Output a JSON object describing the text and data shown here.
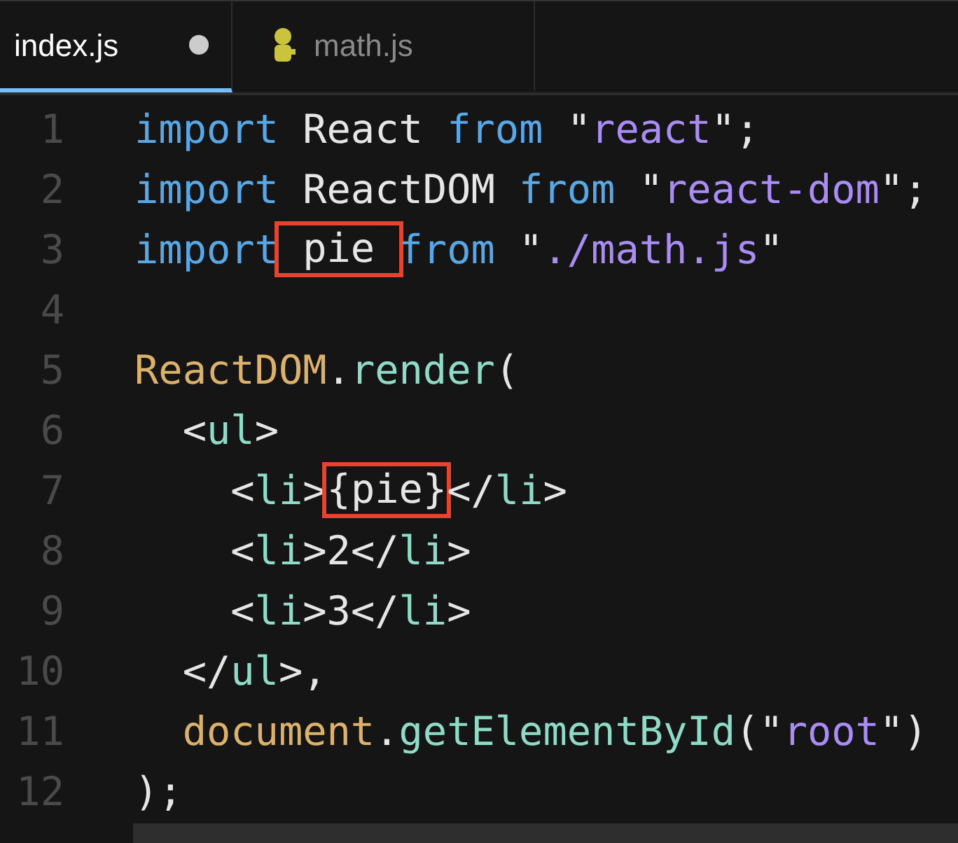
{
  "tabs": [
    {
      "label": "index.js",
      "selected": true,
      "modified": true,
      "icon": false
    },
    {
      "label": "math.js",
      "selected": false,
      "modified": false,
      "icon": true
    }
  ],
  "lines": [
    {
      "number": "1",
      "tokens": [
        {
          "text": "import",
          "kind": "keyword"
        },
        {
          "text": " React ",
          "kind": "plain"
        },
        {
          "text": "from",
          "kind": "keyword"
        },
        {
          "text": " \"",
          "kind": "plain"
        },
        {
          "text": "react",
          "kind": "string"
        },
        {
          "text": "\";",
          "kind": "plain"
        }
      ]
    },
    {
      "number": "2",
      "tokens": [
        {
          "text": "import",
          "kind": "keyword"
        },
        {
          "text": " ReactDOM ",
          "kind": "plain"
        },
        {
          "text": "from",
          "kind": "keyword"
        },
        {
          "text": " \"",
          "kind": "plain"
        },
        {
          "text": "react-dom",
          "kind": "string"
        },
        {
          "text": "\";",
          "kind": "plain"
        }
      ]
    },
    {
      "number": "3",
      "tokens": [
        {
          "text": "import",
          "kind": "keyword"
        },
        {
          "text": " pie ",
          "kind": "plain",
          "boxed": true
        },
        {
          "text": "from",
          "kind": "keyword"
        },
        {
          "text": " \"",
          "kind": "plain"
        },
        {
          "text": "./math.js",
          "kind": "string"
        },
        {
          "text": "\"",
          "kind": "plain"
        }
      ]
    },
    {
      "number": "4"
    },
    {
      "number": "5",
      "tokens": [
        {
          "text": "ReactDOM",
          "kind": "object"
        },
        {
          "text": ".",
          "kind": "plain"
        },
        {
          "text": "render",
          "kind": "method"
        },
        {
          "text": "(",
          "kind": "plain"
        }
      ]
    },
    {
      "number": "6",
      "tokens": [
        {
          "text": "  <",
          "kind": "plain"
        },
        {
          "text": "ul",
          "kind": "tag"
        },
        {
          "text": ">",
          "kind": "plain"
        }
      ]
    },
    {
      "number": "7",
      "tokens": [
        {
          "text": "    <",
          "kind": "plain"
        },
        {
          "text": "li",
          "kind": "tag"
        },
        {
          "text": ">",
          "kind": "plain"
        },
        {
          "text": "{pie}",
          "kind": "plain",
          "boxed": true
        },
        {
          "text": "</",
          "kind": "plain"
        },
        {
          "text": "li",
          "kind": "tag"
        },
        {
          "text": ">",
          "kind": "plain"
        }
      ]
    },
    {
      "number": "8",
      "tokens": [
        {
          "text": "    <",
          "kind": "plain"
        },
        {
          "text": "li",
          "kind": "tag"
        },
        {
          "text": ">2</",
          "kind": "plain"
        },
        {
          "text": "li",
          "kind": "tag"
        },
        {
          "text": ">",
          "kind": "plain"
        }
      ]
    },
    {
      "number": "9",
      "tokens": [
        {
          "text": "    <",
          "kind": "plain"
        },
        {
          "text": "li",
          "kind": "tag"
        },
        {
          "text": ">3</",
          "kind": "plain"
        },
        {
          "text": "li",
          "kind": "tag"
        },
        {
          "text": ">",
          "kind": "plain"
        }
      ]
    },
    {
      "number": "10",
      "tokens": [
        {
          "text": "  </",
          "kind": "plain"
        },
        {
          "text": "ul",
          "kind": "tag"
        },
        {
          "text": ">,",
          "kind": "plain"
        }
      ]
    },
    {
      "number": "11",
      "tokens": [
        {
          "text": "  document",
          "kind": "object"
        },
        {
          "text": ".",
          "kind": "plain"
        },
        {
          "text": "getElementById",
          "kind": "method"
        },
        {
          "text": "(\"",
          "kind": "plain"
        },
        {
          "text": "root",
          "kind": "string"
        },
        {
          "text": "\")",
          "kind": "plain"
        }
      ]
    },
    {
      "number": "12",
      "tokens": [
        {
          "text": ");",
          "kind": "plain"
        }
      ]
    }
  ]
}
